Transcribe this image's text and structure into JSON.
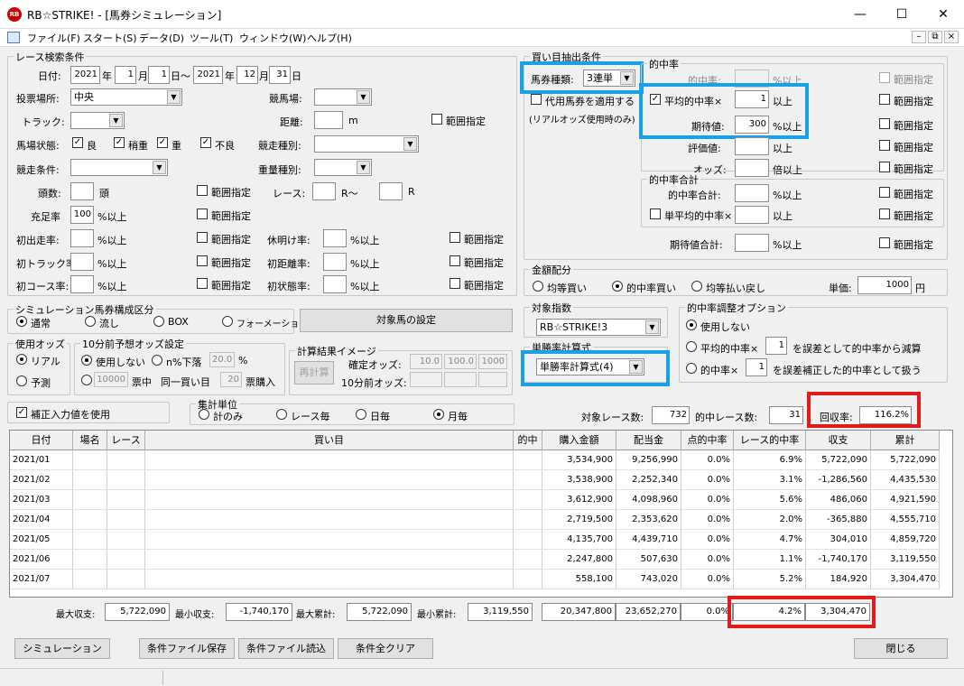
{
  "window": {
    "title": "RB☆STRIKE! - [馬券シミュレーション]",
    "minimize": "—",
    "maximize": "☐",
    "close": "✕",
    "logo": "RB"
  },
  "menu": [
    "ファイル(F)",
    "スタート(S)",
    "データ(D)",
    "ツール(T)",
    "ウィンドウ(W)",
    "ヘルプ(H)"
  ],
  "mdi": {
    "min": "–",
    "restore": "⧉",
    "close": "×"
  },
  "race": {
    "legend": "レース検索条件",
    "date_label": "日付:",
    "from_y": "2021",
    "year": "年",
    "from_m": "1",
    "month": "月",
    "from_d": "1",
    "day_tilde": "日〜",
    "to_y": "2021",
    "to_m": "12",
    "to_d": "31",
    "day": "日",
    "venue_label": "投票場所:",
    "venue": "中央",
    "track_label": "競馬場:",
    "track_type_label": "トラック:",
    "distance_label": "距離:",
    "m": "m",
    "range": "範囲指定",
    "cond_label": "馬場状態:",
    "good": "良",
    "slightly": "稍重",
    "heavy": "重",
    "bad": "不良",
    "kind_label": "競走種別:",
    "race_cond_label": "競走条件:",
    "weight_label": "重量種別:",
    "heads_label": "頭数:",
    "heads_unit": "頭",
    "race_label": "レース:",
    "r_tilde": "R〜",
    "r": "R",
    "fill_label": "充足率",
    "fill_val": "100",
    "pct_over": "%以上",
    "first_label": "初出走率:",
    "rest_label": "休明け率:",
    "first_track_label": "初トラック率:",
    "first_dist_label": "初距離率:",
    "first_course_label": "初コース率:",
    "first_state_label": "初状態率:"
  },
  "sim": {
    "legend": "シミュレーション馬券構成区分",
    "normal": "通常",
    "flow": "流し",
    "box": "BOX",
    "formation": "フォーメーション",
    "target_btn": "対象馬の設定"
  },
  "odds_use": {
    "legend": "使用オッズ",
    "real": "リアル",
    "forecast": "予測"
  },
  "odds10": {
    "legend": "10分前予想オッズ設定",
    "not_use": "使用しない",
    "n_drop": "n%下落",
    "n_val": "20.0",
    "pct": "%",
    "ticket_val": "10000",
    "ticket_hit": "票中",
    "same": "同一買い目",
    "buy_val": "20",
    "buy_unit": "票購入"
  },
  "calc": {
    "legend": "計算結果イメージ",
    "recalc": "再計算",
    "fixed": "確定オッズ:",
    "f1": "10.0",
    "f2": "100.0",
    "f3": "1000",
    "before10": "10分前オッズ:"
  },
  "correct": {
    "label": "補正入力値を使用"
  },
  "agg": {
    "legend": "集計単位",
    "total": "計のみ",
    "race": "レース毎",
    "day": "日毎",
    "month": "月毎"
  },
  "buy": {
    "legend": "買い目抽出条件",
    "type_label": "馬券種類:",
    "type": "3連単",
    "proxy": "代用馬券を適用する",
    "real_only": "(リアルオッズ使用時のみ)"
  },
  "hit": {
    "legend": "的中率",
    "hit_label": "的中率:",
    "avg_label": "平均的中率×",
    "avg_val": "1",
    "over": "以上",
    "ev_label": "期待値:",
    "ev_val": "300",
    "pct_over": "%以上",
    "eval_label": "評価値:",
    "odds_label": "オッズ:",
    "times_over": "倍以上",
    "range": "範囲指定",
    "sum_legend": "的中率合計",
    "sum_label": "的中率合計:",
    "single_avg": "単平均的中率×",
    "ev_sum": "期待値合計:"
  },
  "money": {
    "legend": "金額配分",
    "equal_buy": "均等買い",
    "hit_buy": "的中率買い",
    "equal_refund": "均等払い戻し",
    "unit_label": "単価:",
    "unit_val": "1000",
    "yen": "円"
  },
  "index": {
    "legend": "対象指数",
    "value": "RB☆STRIKE!3"
  },
  "single": {
    "legend": "単勝率計算式",
    "value": "単勝率計算式(4)"
  },
  "adjust": {
    "legend": "的中率調整オプション",
    "none": "使用しない",
    "avg": "平均的中率×",
    "avg_val": "1",
    "avg_desc": "を誤差として的中率から減算",
    "hit": "的中率×",
    "hit_val": "1",
    "hit_desc": "を誤差補正した的中率として扱う"
  },
  "stats": {
    "races_label": "対象レース数:",
    "races": "732",
    "hits_label": "的中レース数:",
    "hits": "31",
    "recovery_label": "回収率:",
    "recovery": "116.2%"
  },
  "table": {
    "headers": [
      "日付",
      "場名",
      "レース",
      "買い目",
      "的中",
      "購入金額",
      "配当金",
      "点的中率",
      "レース的中率",
      "収支",
      "累計"
    ],
    "rows": [
      [
        "2021/01",
        "",
        "",
        "",
        "",
        "3,534,900",
        "9,256,990",
        "0.0%",
        "6.9%",
        "5,722,090",
        "5,722,090"
      ],
      [
        "2021/02",
        "",
        "",
        "",
        "",
        "3,538,900",
        "2,252,340",
        "0.0%",
        "3.1%",
        "-1,286,560",
        "4,435,530"
      ],
      [
        "2021/03",
        "",
        "",
        "",
        "",
        "3,612,900",
        "4,098,960",
        "0.0%",
        "5.6%",
        "486,060",
        "4,921,590"
      ],
      [
        "2021/04",
        "",
        "",
        "",
        "",
        "2,719,500",
        "2,353,620",
        "0.0%",
        "2.0%",
        "-365,880",
        "4,555,710"
      ],
      [
        "2021/05",
        "",
        "",
        "",
        "",
        "4,135,700",
        "4,439,710",
        "0.0%",
        "4.7%",
        "304,010",
        "4,859,720"
      ],
      [
        "2021/06",
        "",
        "",
        "",
        "",
        "2,247,800",
        "507,630",
        "0.0%",
        "1.1%",
        "-1,740,170",
        "3,119,550"
      ],
      [
        "2021/07",
        "",
        "",
        "",
        "",
        "558,100",
        "743,020",
        "0.0%",
        "5.2%",
        "184,920",
        "3,304,470"
      ]
    ]
  },
  "summary": {
    "max_label": "最大収支:",
    "max": "5,722,090",
    "min_label": "最小収支:",
    "min": "-1,740,170",
    "max_cum_label": "最大累計:",
    "max_cum": "5,722,090",
    "min_cum_label": "最小累計:",
    "min_cum": "3,119,550",
    "buy_total": "20,347,800",
    "pay_total": "23,652,270",
    "pt_hit": "0.0%",
    "race_hit": "4.2%",
    "cum": "3,304,470"
  },
  "buttons": {
    "simulate": "シミュレーション",
    "save": "条件ファイル保存",
    "load": "条件ファイル読込",
    "clear": "条件全クリア",
    "close": "閉じる"
  },
  "check": "✓",
  "arrow": "▼"
}
